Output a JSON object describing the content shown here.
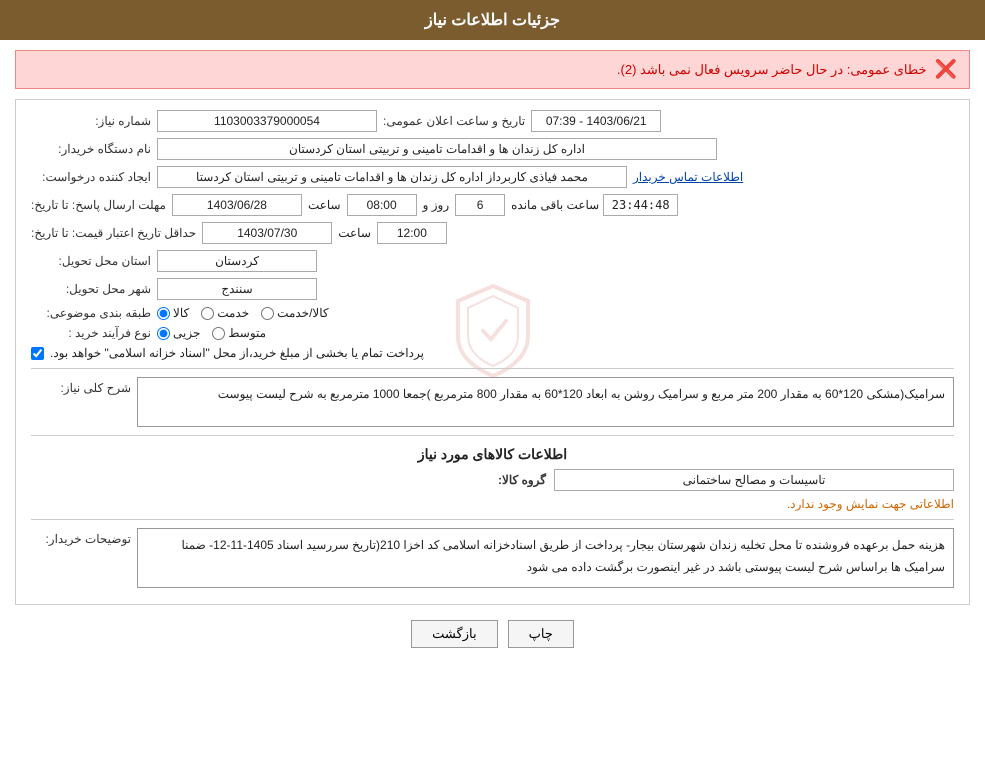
{
  "header": {
    "title": "جزئیات اطلاعات نیاز"
  },
  "error": {
    "message": "خطای عمومی: در حال حاضر سرویس فعال نمی باشد (2)."
  },
  "form": {
    "need_number_label": "شماره نیاز:",
    "need_number_value": "1103003379000054",
    "announce_date_label": "تاریخ و ساعت اعلان عمومی:",
    "announce_date_value": "1403/06/21 - 07:39",
    "buyer_org_label": "نام دستگاه خریدار:",
    "buyer_org_value": "اداره کل زندان ها و اقدامات تامینی و تربیتی استان کردستان",
    "creator_label": "ایجاد کننده درخواست:",
    "creator_value": "محمد  فیاذی کاربرداز اداره کل زندان ها و اقدامات تامینی و تربیتی استان کردستا",
    "creator_link": "اطلاعات تماس خریدار",
    "response_deadline_label": "مهلت ارسال پاسخ: تا تاریخ:",
    "response_date_value": "1403/06/28",
    "response_time_label": "ساعت",
    "response_time_value": "08:00",
    "response_day_label": "روز و",
    "response_day_value": "6",
    "remaining_time_label": "ساعت باقی مانده",
    "remaining_time_value": "23:44:48",
    "price_valid_label": "حداقل تاریخ اعتبار قیمت: تا تاریخ:",
    "price_valid_date": "1403/07/30",
    "price_valid_time_label": "ساعت",
    "price_valid_time": "12:00",
    "province_label": "استان محل تحویل:",
    "province_value": "کردستان",
    "city_label": "شهر محل تحویل:",
    "city_value": "سنندج",
    "type_label": "طبقه بندی موضوعی:",
    "type_options": [
      "کالا",
      "خدمت",
      "کالا/خدمت"
    ],
    "type_selected": "کالا",
    "process_label": "نوع فرآیند خرید :",
    "process_options": [
      "جزیی",
      "متوسط"
    ],
    "process_selected": "جزیی",
    "payment_checkbox_label": "پرداخت تمام یا بخشی از مبلغ خرید،از محل \"اسناد خزانه اسلامی\" خواهد بود.",
    "payment_checked": true,
    "description_label": "شرح کلی نیاز:",
    "description_value": "سرامیک(مشکی  120*60  به مقدار 200 متر مربع  و  سرامیک روشن به ابعاد 120*60 به مقدار 800 مترمربع )جمعا 1000 مترمربع به شرح لیست پیوست",
    "goods_info_label": "اطلاعات کالاهای مورد نیاز",
    "goods_group_label": "گروه کالا:",
    "goods_group_value": "تاسیسات و مصالح ساختمانی",
    "no_info_text": "اطلاعاتی جهت نمایش وجود ندارد.",
    "buyer_desc_label": "توضیحات خریدار:",
    "buyer_desc_value": "هزینه حمل برعهده فروشنده  تا محل  تخلیه  زندان  شهرستان بیجار- پرداخت از طریق اسنادخزانه اسلامی کد اخزا  210(تاریخ سررسید اسناد 1405-11-12- ضمنا سرامیک ها براساس شرح لیست پیوستی باشد در غیر اینصورت برگشت داده می شود"
  },
  "buttons": {
    "print_label": "چاپ",
    "back_label": "بازگشت"
  }
}
